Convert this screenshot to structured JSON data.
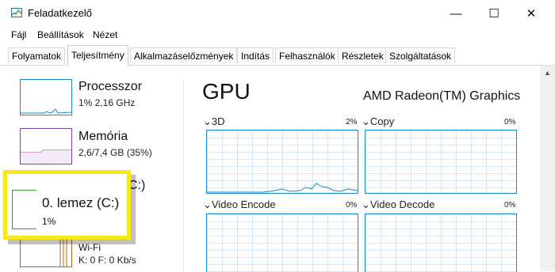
{
  "window": {
    "title": "Feladatkezelő",
    "controls": {
      "minimize": "—",
      "maximize": "☐",
      "close": "✕"
    }
  },
  "menu": [
    "Fájl",
    "Beállítások",
    "Nézet"
  ],
  "tabs": [
    {
      "label": "Folyamatok",
      "active": false
    },
    {
      "label": "Teljesítmény",
      "active": true
    },
    {
      "label": "Alkalmazáselőzmények",
      "active": false
    },
    {
      "label": "Indítás",
      "active": false
    },
    {
      "label": "Felhasználók",
      "active": false
    },
    {
      "label": "Részletek",
      "active": false
    },
    {
      "label": "Szolgáltatások",
      "active": false
    }
  ],
  "sidebar": {
    "items": [
      {
        "name": "Processzor",
        "detail": "1% 2,16 GHz"
      },
      {
        "name": "Memória",
        "detail": "2,6/7,4 GB (35%)"
      },
      {
        "name": "0. lemez (C:)",
        "detail": "1%",
        "hidden_suffix": "C:)"
      },
      {
        "name": "Wi-Fi",
        "detail": "K: 0 F: 0 Kb/s"
      }
    ]
  },
  "main": {
    "title": "GPU",
    "device": "AMD Radeon(TM) Graphics",
    "engines": [
      {
        "label": "3D",
        "percent": "2%"
      },
      {
        "label": "Copy",
        "percent": "0%"
      },
      {
        "label": "Video Encode",
        "percent": "0%"
      },
      {
        "label": "Video Decode",
        "percent": "0%"
      }
    ]
  },
  "colors": {
    "graph_border": "#1a88c9",
    "highlight": "#f7e81b"
  }
}
